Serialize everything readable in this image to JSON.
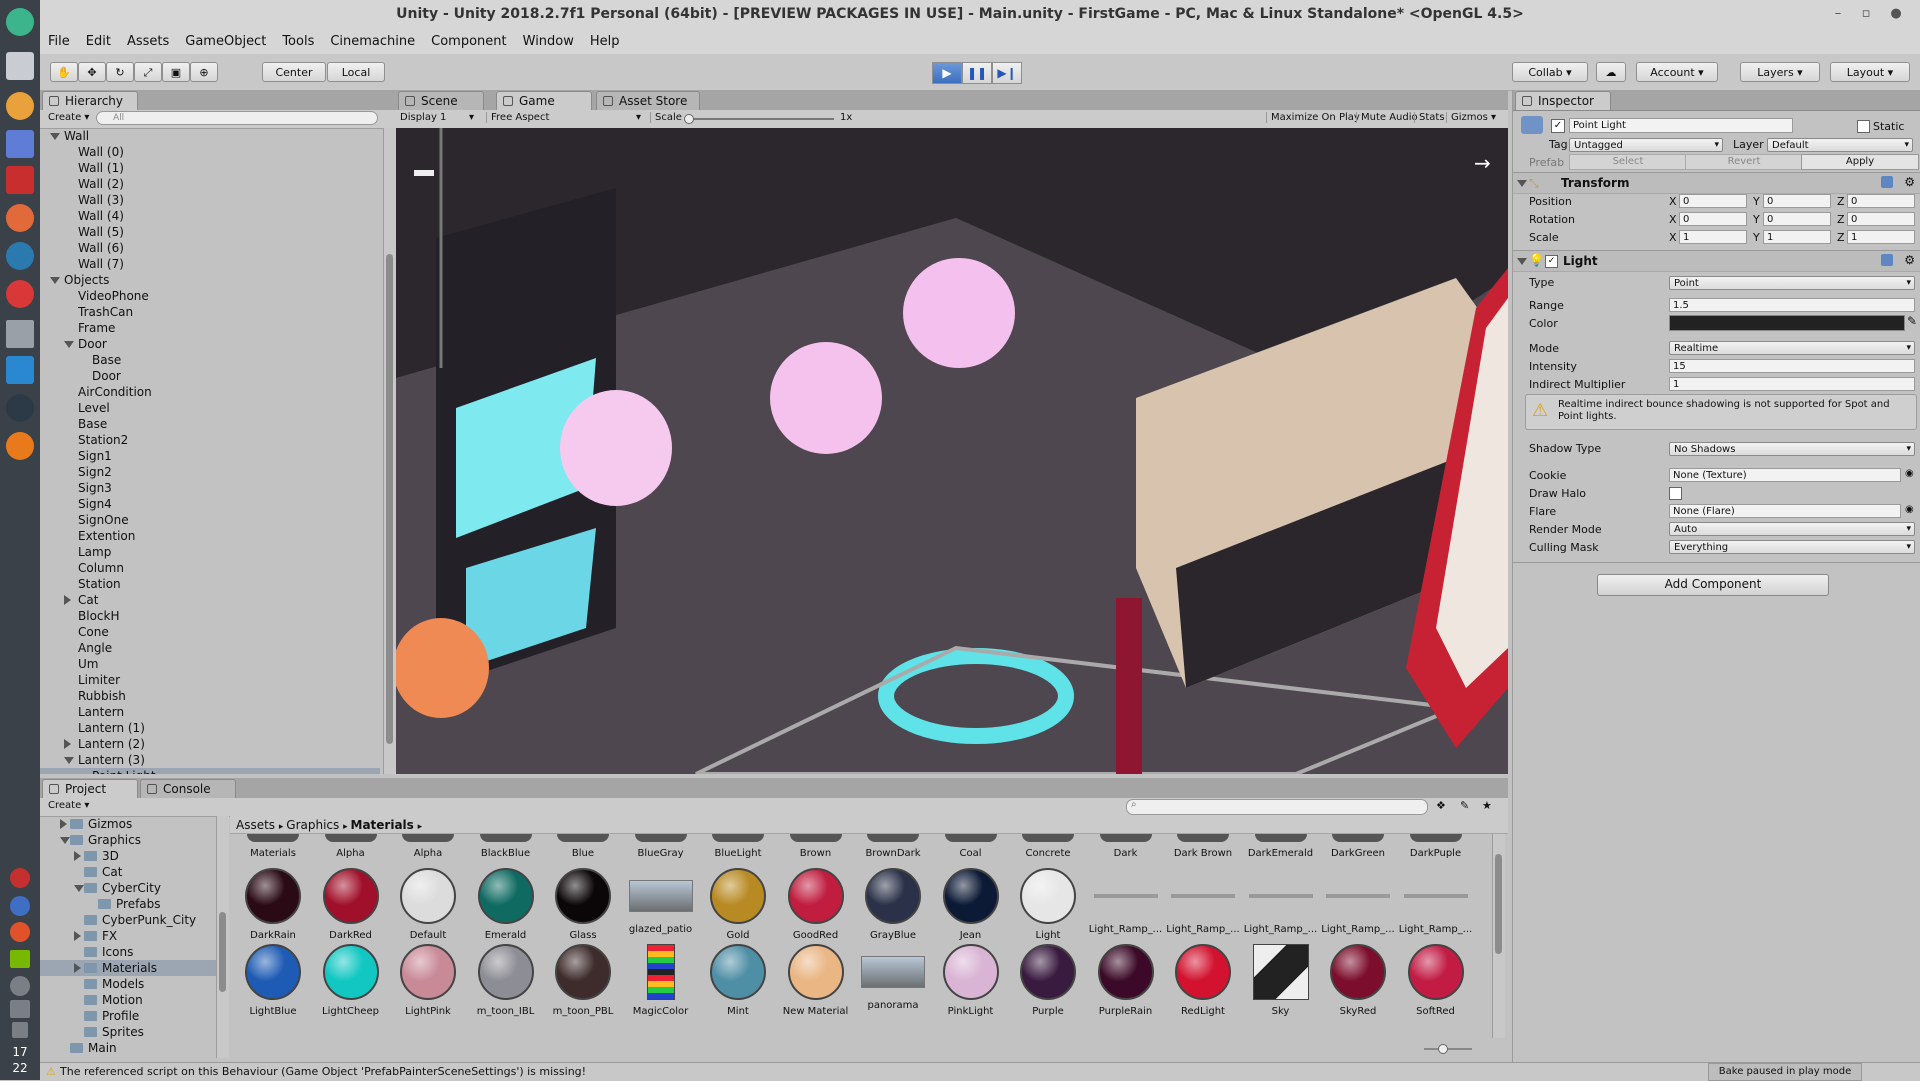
{
  "window": {
    "title": "Unity - Unity 2018.2.7f1 Personal (64bit) - [PREVIEW PACKAGES IN USE] - Main.unity - FirstGame - PC, Mac & Linux Standalone* <OpenGL 4.5>"
  },
  "launcher": {
    "clock_hour": "17",
    "clock_minute": "22"
  },
  "menubar": [
    "File",
    "Edit",
    "Assets",
    "GameObject",
    "Tools",
    "Cinemachine",
    "Component",
    "Window",
    "Help"
  ],
  "toolbar": {
    "center_label": "Center",
    "local_label": "Local",
    "collab_label": "Collab",
    "account_label": "Account",
    "layers_label": "Layers",
    "layout_label": "Layout"
  },
  "hierarchy": {
    "tab": "Hierarchy",
    "create_label": "Create",
    "search_placeholder": "All",
    "rows": [
      {
        "label": "Wall",
        "indent": 0,
        "arrow": "down"
      },
      {
        "label": "Wall (0)",
        "indent": 1,
        "arrow": ""
      },
      {
        "label": "Wall (1)",
        "indent": 1,
        "arrow": ""
      },
      {
        "label": "Wall (2)",
        "indent": 1,
        "arrow": ""
      },
      {
        "label": "Wall (3)",
        "indent": 1,
        "arrow": ""
      },
      {
        "label": "Wall (4)",
        "indent": 1,
        "arrow": ""
      },
      {
        "label": "Wall (5)",
        "indent": 1,
        "arrow": ""
      },
      {
        "label": "Wall (6)",
        "indent": 1,
        "arrow": ""
      },
      {
        "label": "Wall (7)",
        "indent": 1,
        "arrow": ""
      },
      {
        "label": "Objects",
        "indent": 0,
        "arrow": "down"
      },
      {
        "label": "VideoPhone",
        "indent": 1,
        "arrow": ""
      },
      {
        "label": "TrashCan",
        "indent": 1,
        "arrow": ""
      },
      {
        "label": "Frame",
        "indent": 1,
        "arrow": ""
      },
      {
        "label": "Door",
        "indent": 1,
        "arrow": "down"
      },
      {
        "label": "Base",
        "indent": 2,
        "arrow": ""
      },
      {
        "label": "Door",
        "indent": 2,
        "arrow": ""
      },
      {
        "label": "AirCondition",
        "indent": 1,
        "arrow": ""
      },
      {
        "label": "Level",
        "indent": 1,
        "arrow": ""
      },
      {
        "label": "Base",
        "indent": 1,
        "arrow": ""
      },
      {
        "label": "Station2",
        "indent": 1,
        "arrow": ""
      },
      {
        "label": "Sign1",
        "indent": 1,
        "arrow": ""
      },
      {
        "label": "Sign2",
        "indent": 1,
        "arrow": ""
      },
      {
        "label": "Sign3",
        "indent": 1,
        "arrow": ""
      },
      {
        "label": "Sign4",
        "indent": 1,
        "arrow": ""
      },
      {
        "label": "SignOne",
        "indent": 1,
        "arrow": ""
      },
      {
        "label": "Extention",
        "indent": 1,
        "arrow": ""
      },
      {
        "label": "Lamp",
        "indent": 1,
        "arrow": ""
      },
      {
        "label": "Column",
        "indent": 1,
        "arrow": ""
      },
      {
        "label": "Station",
        "indent": 1,
        "arrow": ""
      },
      {
        "label": "Cat",
        "indent": 1,
        "arrow": "right"
      },
      {
        "label": "BlockH",
        "indent": 1,
        "arrow": ""
      },
      {
        "label": "Cone",
        "indent": 1,
        "arrow": ""
      },
      {
        "label": "Angle",
        "indent": 1,
        "arrow": ""
      },
      {
        "label": "Um",
        "indent": 1,
        "arrow": ""
      },
      {
        "label": "Limiter",
        "indent": 1,
        "arrow": ""
      },
      {
        "label": "Rubbish",
        "indent": 1,
        "arrow": ""
      },
      {
        "label": "Lantern",
        "indent": 1,
        "arrow": ""
      },
      {
        "label": "Lantern (1)",
        "indent": 1,
        "arrow": ""
      },
      {
        "label": "Lantern (2)",
        "indent": 1,
        "arrow": "right"
      },
      {
        "label": "Lantern (3)",
        "indent": 1,
        "arrow": "down"
      },
      {
        "label": "Point Light",
        "indent": 2,
        "arrow": "",
        "selected": true
      }
    ]
  },
  "game": {
    "tabs": [
      "Scene",
      "Game",
      "Asset Store"
    ],
    "display": "Display 1",
    "aspect": "Free Aspect",
    "scale_label": "Scale",
    "scale_value": "1x",
    "options": [
      "Maximize On Play",
      "Mute Audio",
      "Stats",
      "Gizmos"
    ]
  },
  "inspector": {
    "tab": "Inspector",
    "object_name": "Point Light",
    "static_label": "Static",
    "tag_label": "Tag",
    "tag_value": "Untagged",
    "layer_label": "Layer",
    "layer_value": "Default",
    "prefab_label": "Prefab",
    "prefab_buttons": [
      "Select",
      "Revert",
      "Apply"
    ],
    "transform": {
      "title": "Transform",
      "rows": [
        {
          "label": "Position",
          "x": "0",
          "y": "0",
          "z": "0"
        },
        {
          "label": "Rotation",
          "x": "0",
          "y": "0",
          "z": "0"
        },
        {
          "label": "Scale",
          "x": "1",
          "y": "1",
          "z": "1"
        }
      ]
    },
    "light": {
      "title": "Light",
      "type_label": "Type",
      "type_value": "Point",
      "range_label": "Range",
      "range_value": "1.5",
      "color_label": "Color",
      "mode_label": "Mode",
      "mode_value": "Realtime",
      "intensity_label": "Intensity",
      "intensity_value": "15",
      "indirect_label": "Indirect Multiplier",
      "indirect_value": "1",
      "warning": "Realtime indirect bounce shadowing is not supported for Spot and Point lights.",
      "shadow_label": "Shadow Type",
      "shadow_value": "No Shadows",
      "cookie_label": "Cookie",
      "cookie_value": "None (Texture)",
      "halo_label": "Draw Halo",
      "flare_label": "Flare",
      "flare_value": "None (Flare)",
      "render_label": "Render Mode",
      "render_value": "Auto",
      "culling_label": "Culling Mask",
      "culling_value": "Everything"
    },
    "add_component": "Add Component",
    "bake_status": "Bake paused in play mode"
  },
  "project": {
    "tabs": [
      "Project",
      "Console"
    ],
    "create_label": "Create",
    "breadcrumb": [
      "Assets",
      "Graphics",
      "Materials"
    ],
    "tree": [
      {
        "label": "Gizmos",
        "indent": 1,
        "arrow": "right"
      },
      {
        "label": "Graphics",
        "indent": 1,
        "arrow": "down"
      },
      {
        "label": "3D",
        "indent": 2,
        "arrow": "right"
      },
      {
        "label": "Cat",
        "indent": 2,
        "arrow": ""
      },
      {
        "label": "CyberCity",
        "indent": 2,
        "arrow": "down"
      },
      {
        "label": "Prefabs",
        "indent": 3,
        "arrow": ""
      },
      {
        "label": "CyberPunk_City",
        "indent": 2,
        "arrow": ""
      },
      {
        "label": "FX",
        "indent": 2,
        "arrow": "right"
      },
      {
        "label": "Icons",
        "indent": 2,
        "arrow": ""
      },
      {
        "label": "Materials",
        "indent": 2,
        "arrow": "right",
        "selected": true
      },
      {
        "label": "Models",
        "indent": 2,
        "arrow": ""
      },
      {
        "label": "Motion",
        "indent": 2,
        "arrow": ""
      },
      {
        "label": "Profile",
        "indent": 2,
        "arrow": ""
      },
      {
        "label": "Sprites",
        "indent": 2,
        "arrow": ""
      },
      {
        "label": "Main",
        "indent": 1,
        "arrow": ""
      }
    ],
    "row0": [
      "Materials",
      "Alpha",
      "Alpha",
      "BlackBlue",
      "Blue",
      "BlueGray",
      "BlueLight",
      "Brown",
      "BrownDark",
      "Coal",
      "Concrete",
      "Dark",
      "Dark Brown",
      "DarkEmerald",
      "DarkGreen",
      "DarkPuple"
    ],
    "row1": [
      {
        "label": "DarkRain",
        "color": "#2a0a14"
      },
      {
        "label": "DarkRed",
        "color": "#a0102a"
      },
      {
        "label": "Default",
        "color": "#dcdcdc"
      },
      {
        "label": "Emerald",
        "color": "#0f6b62"
      },
      {
        "label": "Glass",
        "color": "#0b0607"
      },
      {
        "label": "glazed_patio",
        "color": "#8f9aa6",
        "kind": "tex"
      },
      {
        "label": "Gold",
        "color": "#b88a24"
      },
      {
        "label": "GoodRed",
        "color": "#c01d3f"
      },
      {
        "label": "GrayBlue",
        "color": "#2a3148"
      },
      {
        "label": "Jean",
        "color": "#0d1a36"
      },
      {
        "label": "Light",
        "color": "#e6e6e6"
      },
      {
        "label": "Light_Ramp_...",
        "color": "",
        "kind": "line"
      },
      {
        "label": "Light_Ramp_...",
        "color": "",
        "kind": "line"
      },
      {
        "label": "Light_Ramp_...",
        "color": "",
        "kind": "line"
      },
      {
        "label": "Light_Ramp_...",
        "color": "",
        "kind": "line"
      },
      {
        "label": "Light_Ramp_...",
        "color": "",
        "kind": "line"
      }
    ],
    "row2": [
      {
        "label": "LightBlue",
        "color": "#1e5bb4"
      },
      {
        "label": "LightCheep",
        "color": "#12c7c2"
      },
      {
        "label": "LightPink",
        "color": "#c98a98"
      },
      {
        "label": "m_toon_IBL",
        "color": "#8d8d95"
      },
      {
        "label": "m_toon_PBL",
        "color": "#3e2b2b"
      },
      {
        "label": "MagicColor",
        "color": "",
        "kind": "stripes"
      },
      {
        "label": "Mint",
        "color": "#4f8fa6"
      },
      {
        "label": "New Material",
        "color": "#e9b684"
      },
      {
        "label": "panorama",
        "color": "#8e96a0",
        "kind": "tex"
      },
      {
        "label": "PinkLight",
        "color": "#d9b4d4"
      },
      {
        "label": "Purple",
        "color": "#3a1b40"
      },
      {
        "label": "PurpleRain",
        "color": "#3c0a28"
      },
      {
        "label": "RedLight",
        "color": "#d2122e"
      },
      {
        "label": "Sky",
        "color": "#d8d8d8",
        "kind": "sky"
      },
      {
        "label": "SkyRed",
        "color": "#7c0d2c"
      },
      {
        "label": "SoftRed",
        "color": "#c21c44"
      }
    ]
  },
  "status": {
    "message": "The referenced script on this Behaviour (Game Object 'PrefabPainterSceneSettings') is missing!"
  }
}
